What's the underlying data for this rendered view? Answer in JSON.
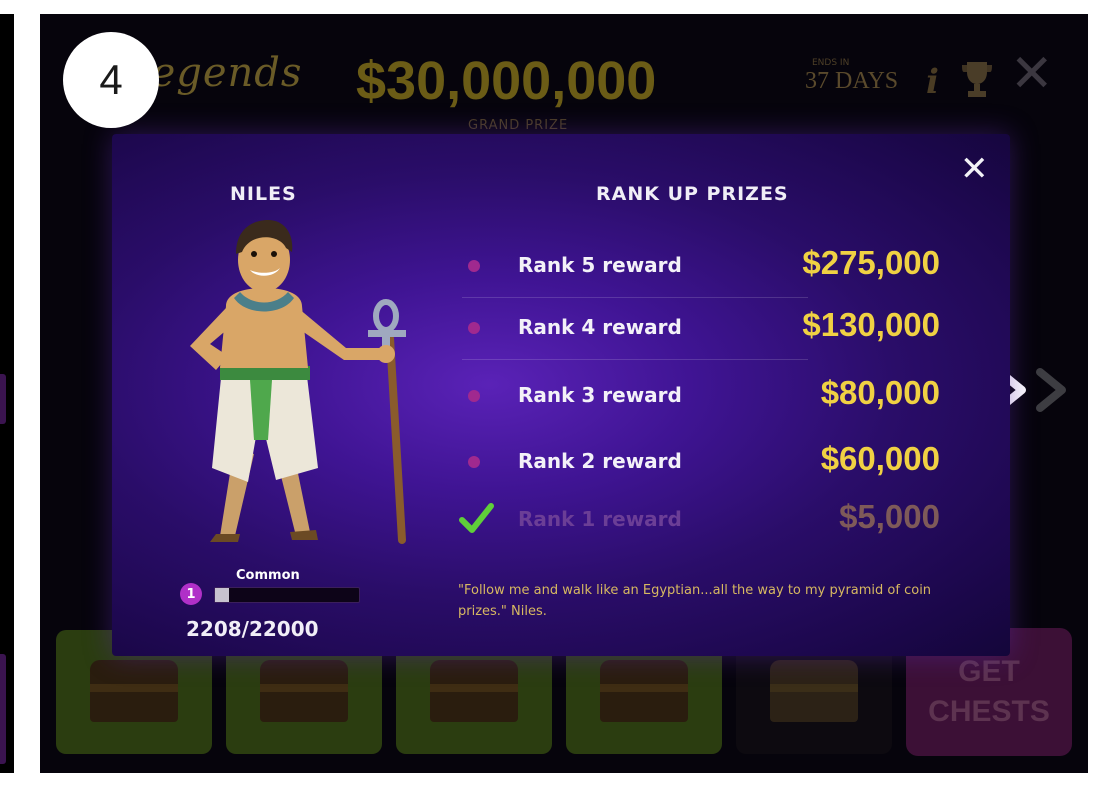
{
  "step_number": "4",
  "header": {
    "logo": "Legends",
    "grand_prize": "$30,000,000",
    "grand_prize_label": "GRAND PRIZE",
    "ends_in_label": "ENDS IN",
    "days_left": "37 DAYS"
  },
  "modal": {
    "hero_name": "NILES",
    "section_title": "RANK UP PRIZES",
    "rewards": [
      {
        "label": "Rank 5 reward",
        "value": "$275,000",
        "claimed": false
      },
      {
        "label": "Rank 4 reward",
        "value": "$130,000",
        "claimed": false
      },
      {
        "label": "Rank 3 reward",
        "value": "$80,000",
        "claimed": false
      },
      {
        "label": "Rank 2 reward",
        "value": "$60,000",
        "claimed": false
      },
      {
        "label": "Rank 1 reward",
        "value": "$5,000",
        "claimed": true
      }
    ],
    "rarity": "Common",
    "level": "1",
    "xp_text": "2208/22000",
    "xp_fraction": 0.1,
    "quote": "\"Follow me and walk like an Egyptian...all the way to my pyramid of coin prizes.\" Niles."
  },
  "bottom": {
    "get_chests_line1": "GET",
    "get_chests_line2": "CHESTS"
  },
  "colors": {
    "accent_gold": "#f0d143",
    "modal_purple": "#3f1493",
    "claimed_check": "#5fcf3a"
  },
  "icons": [
    "close-icon",
    "info-icon",
    "trophy-icon",
    "chevron-right-icon",
    "check-icon",
    "chest-icon",
    "hero-avatar"
  ]
}
